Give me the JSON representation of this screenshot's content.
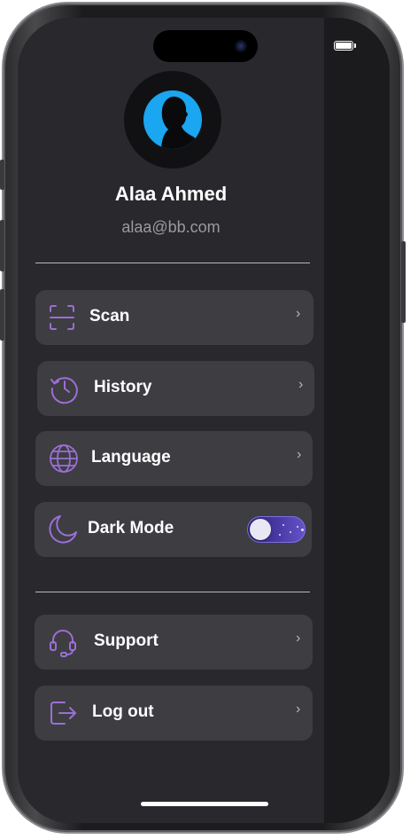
{
  "profile": {
    "name": "Alaa Ahmed",
    "email": "alaa@bb.com",
    "avatar_icon": "person-silhouette-icon"
  },
  "menu": {
    "items": [
      {
        "id": "scan",
        "label": "Scan",
        "icon": "scan-frame-icon",
        "chevron": "›"
      },
      {
        "id": "history",
        "label": "History",
        "icon": "history-clock-icon",
        "chevron": "›"
      },
      {
        "id": "language",
        "label": "Language",
        "icon": "globe-icon",
        "chevron": "›"
      },
      {
        "id": "dark_mode",
        "label": "Dark Mode",
        "icon": "moon-icon",
        "toggle_on": true
      }
    ],
    "secondary_items": [
      {
        "id": "support",
        "label": "Support",
        "icon": "headset-icon",
        "chevron": "›"
      },
      {
        "id": "logout",
        "label": "Log out",
        "icon": "logout-icon",
        "chevron": "›"
      }
    ]
  },
  "colors": {
    "accent": "#9b6fd6",
    "avatar_ring": "#1aa6f0",
    "drawer_bg": "#29282c",
    "item_bg": "#3e3d42",
    "text_primary": "#ffffff",
    "text_secondary": "#9a9aa0"
  }
}
